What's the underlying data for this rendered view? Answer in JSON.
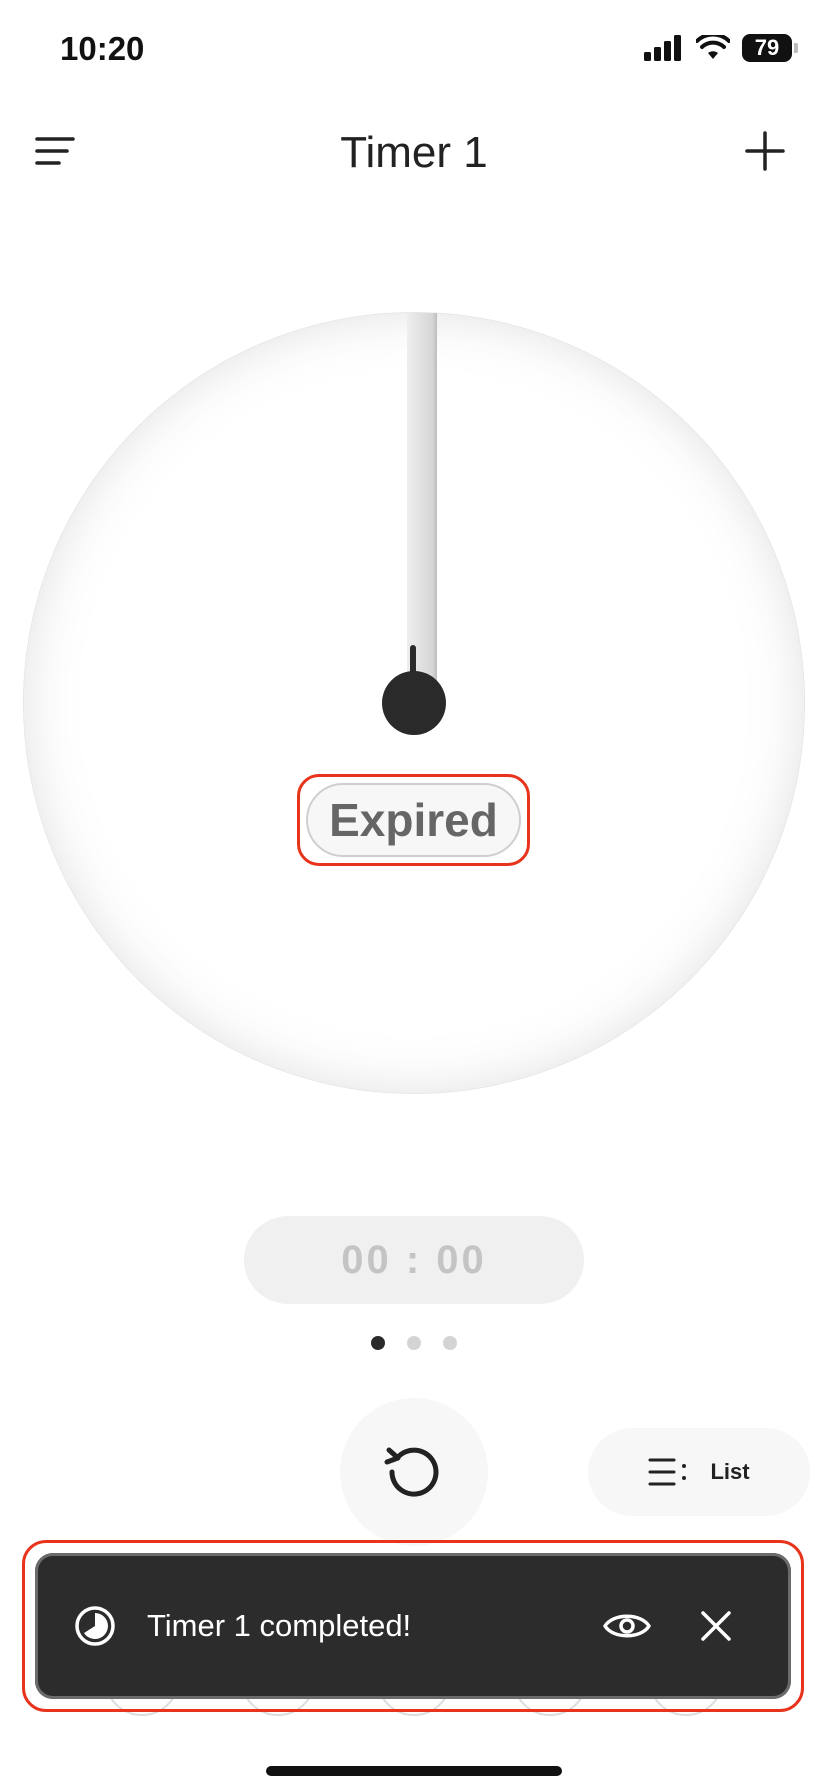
{
  "status_bar": {
    "time": "10:20",
    "battery": "79"
  },
  "header": {
    "title": "Timer 1"
  },
  "dial": {
    "state_label": "Expired"
  },
  "timer": {
    "remaining": "00 : 00"
  },
  "pager": {
    "count": 3,
    "active": 0
  },
  "controls": {
    "list_label": "List"
  },
  "toast": {
    "message": "Timer 1 completed!"
  },
  "icons": {
    "menu": "menu-lines-icon",
    "add": "plus-icon",
    "reset": "reset-icon",
    "list": "list-icon",
    "timer": "timer-icon",
    "view": "eye-icon",
    "close": "close-icon"
  },
  "colors": {
    "highlight": "#e8341c",
    "toast_bg": "#2c2c2c",
    "knob": "#2a2a2a"
  }
}
